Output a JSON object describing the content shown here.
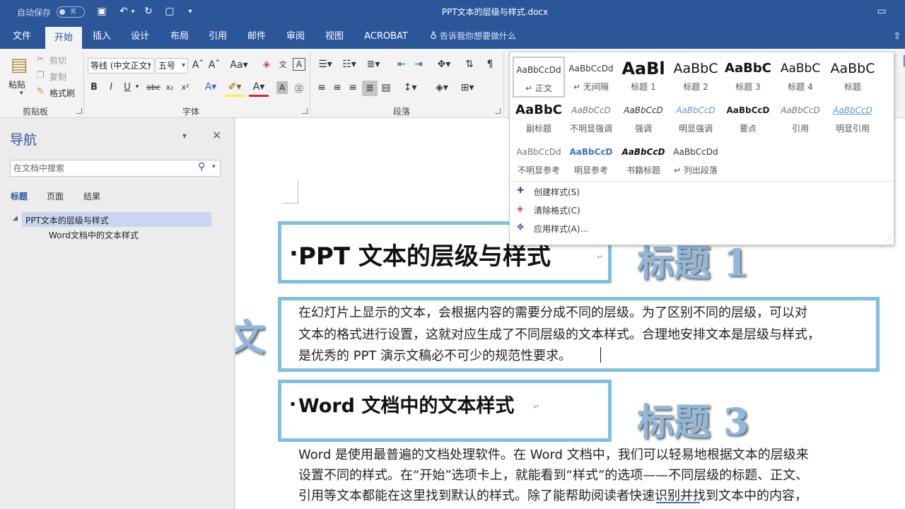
{
  "titlebar": {
    "autosave_label": "自动保存",
    "autosave_state": "关",
    "doc_title": "PPT文本的层级与样式.docx"
  },
  "tabs": [
    "文件",
    "开始",
    "插入",
    "设计",
    "布局",
    "引用",
    "邮件",
    "审阅",
    "视图",
    "ACROBAT"
  ],
  "tell_me": "告诉我你想要做什么",
  "ribbon": {
    "clipboard": {
      "paste": "粘贴",
      "cut": "剪切",
      "copy": "复制",
      "format_painter": "格式刷",
      "label": "剪贴板"
    },
    "font": {
      "font_name": "等线 (中文正文)",
      "font_size": "五号",
      "label": "字体"
    },
    "paragraph": {
      "label": "段落"
    }
  },
  "gallery": {
    "styles": [
      {
        "preview": "AaBbCcDd",
        "name": "↵ 正文"
      },
      {
        "preview": "AaBbCcDd",
        "name": "↵ 无间隔"
      },
      {
        "preview": "AaBl",
        "name": "标题 1"
      },
      {
        "preview": "AaBbC",
        "name": "标题 2"
      },
      {
        "preview": "AaBbC",
        "name": "标题 3"
      },
      {
        "preview": "AaBbC",
        "name": "标题 4"
      },
      {
        "preview": "AaBbC",
        "name": "标题"
      },
      {
        "preview": "AaBbC",
        "name": "副标题"
      },
      {
        "preview": "AaBbCcD",
        "name": "不明显强调"
      },
      {
        "preview": "AaBbCcD",
        "name": "强调"
      },
      {
        "preview": "AaBbCcD",
        "name": "明显强调"
      },
      {
        "preview": "AaBbCcD",
        "name": "要点"
      },
      {
        "preview": "AaBbCcD",
        "name": "引用"
      },
      {
        "preview": "AaBbCcD",
        "name": "明显引用"
      },
      {
        "preview": "AaBbCcDd",
        "name": "不明显参考"
      },
      {
        "preview": "AaBbCcD",
        "name": "明显参考"
      },
      {
        "preview": "AaBbCcD",
        "name": "书籍标题"
      },
      {
        "preview": "AaBbCcDd",
        "name": "↵ 列出段落"
      }
    ],
    "actions": [
      "创建样式(S)",
      "清除格式(C)",
      "应用样式(A)..."
    ]
  },
  "nav": {
    "title": "导航",
    "search_placeholder": "在文档中搜索",
    "tabs": [
      "标题",
      "页面",
      "结果"
    ],
    "tree": [
      "PPT文本的层级与样式",
      "Word文档中的文本样式"
    ]
  },
  "doc": {
    "heading1": "PPT 文本的层级与样式",
    "para1": [
      "在幻灯片上显示的文本，会根据内容的需要分成不同的层级。为了区别不同的层级，可以对",
      "文本的格式进行设置，这就对应生成了不同层级的文本样式。合理地安排文本是层级与样式，",
      "是优秀的 PPT 演示文稿必不可少的规范性要求。"
    ],
    "heading3": "Word 文档中的文本样式",
    "para2": [
      "Word 是使用最普遍的文档处理软件。在 Word 文档中，我们可以轻易地根据文本的层级来",
      "设置不同的样式。在“开始”选项卡上，就能看到“样式”的选项——不同层级的标题、正文、",
      "引用等文本都能在这里找到默认的样式。除了能帮助阅读者快速识别并找到文本中的内容，"
    ]
  },
  "annotations": {
    "h1": "标题 1",
    "body": "正文",
    "h3": "标题 3"
  },
  "colors": {
    "word_blue": "#2b579a",
    "box_blue": "#7fbfe0",
    "annotation": "#8fb8dc"
  }
}
